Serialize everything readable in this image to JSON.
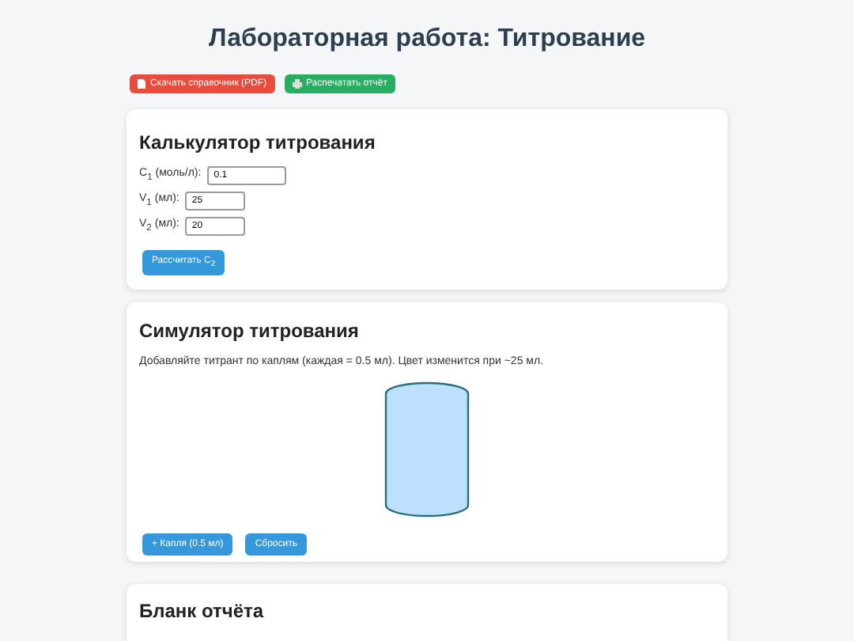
{
  "title": "Лабораторная работа: Титрование",
  "actions": [
    {
      "kind": "pdf",
      "label": "Скачать справочник (PDF)"
    },
    {
      "kind": "print",
      "label": "Распечатать отчёт"
    }
  ],
  "calculator": {
    "title": "Калькулятор титрования",
    "fields": [
      {
        "label": "C$_{1}$ (моль/л):",
        "value": "0.1"
      },
      {
        "label": "V$_{1}$ (мл):",
        "value": "25"
      },
      {
        "label": "V$_{2}$ (мл):",
        "value": "20"
      }
    ],
    "button": "Рассчитать C$_{2}$"
  },
  "simulator": {
    "title": "Симулятор титрования",
    "text": "Добавляйте титрант по каплям (каждая = 0.5 мл). Цвет изменится при ~25 мл.",
    "buttons": [
      "+ Капля (0.5 мл)",
      "Сбросить"
    ]
  },
  "report": {
    "title": "Бланк отчёта"
  }
}
